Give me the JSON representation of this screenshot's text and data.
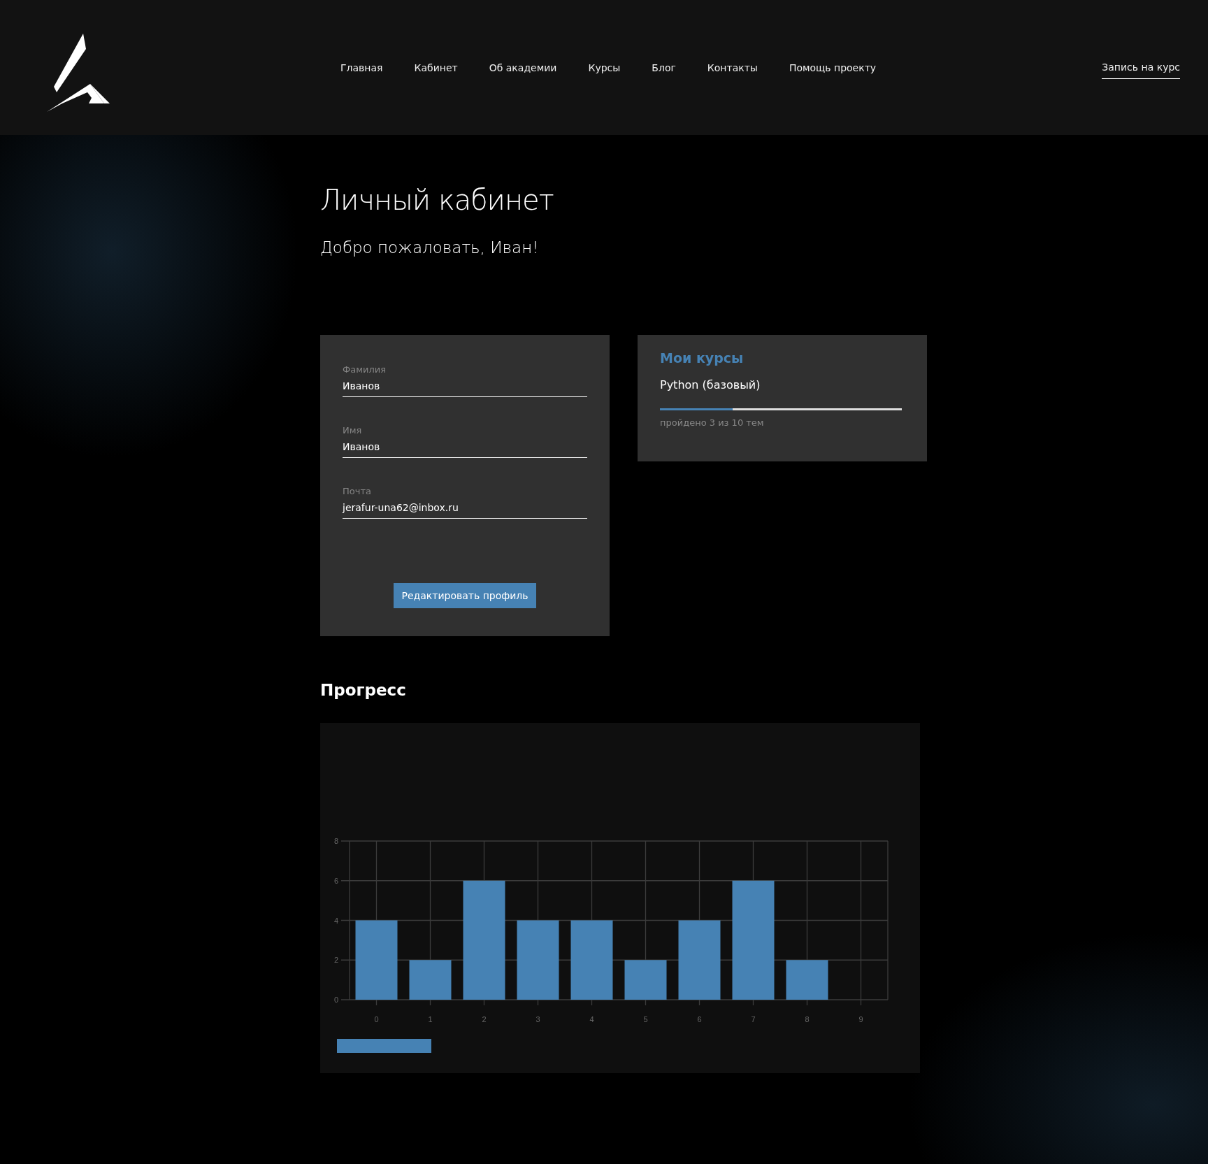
{
  "header": {
    "nav": [
      {
        "label": "Главная"
      },
      {
        "label": "Кабинет"
      },
      {
        "label": "Об академии"
      },
      {
        "label": "Курсы"
      },
      {
        "label": "Блог"
      },
      {
        "label": "Контакты"
      },
      {
        "label": "Помощь проекту"
      }
    ],
    "cta": "Запись на курс"
  },
  "page": {
    "title": "Личный кабинет",
    "greeting": "Добро пожаловать, Иван!"
  },
  "profile": {
    "fields": [
      {
        "label": "Фамилия",
        "value": "Иванов"
      },
      {
        "label": "Имя",
        "value": "Иванов"
      },
      {
        "label": "Почта",
        "value": "jerafur-una62@inbox.ru"
      }
    ],
    "button": "Редактировать профиль"
  },
  "courses": {
    "title": "Мои курсы",
    "items": [
      {
        "name": "Python (базовый)",
        "level": 0.3,
        "caption": "пройдено 3 из 10 тем"
      }
    ]
  },
  "progress": {
    "title": "Прогресс",
    "chart_data": {
      "type": "bar",
      "categories": [
        "0",
        "1",
        "2",
        "3",
        "4",
        "5",
        "6",
        "7",
        "8",
        "9"
      ],
      "series": [
        {
          "color": "#4682b4",
          "values": [
            4,
            2,
            6,
            4,
            4,
            2,
            4,
            6,
            2,
            null
          ]
        }
      ],
      "grid": true,
      "ylim": [
        0,
        8
      ],
      "yticks": [
        0,
        2,
        4,
        6,
        8
      ]
    }
  }
}
